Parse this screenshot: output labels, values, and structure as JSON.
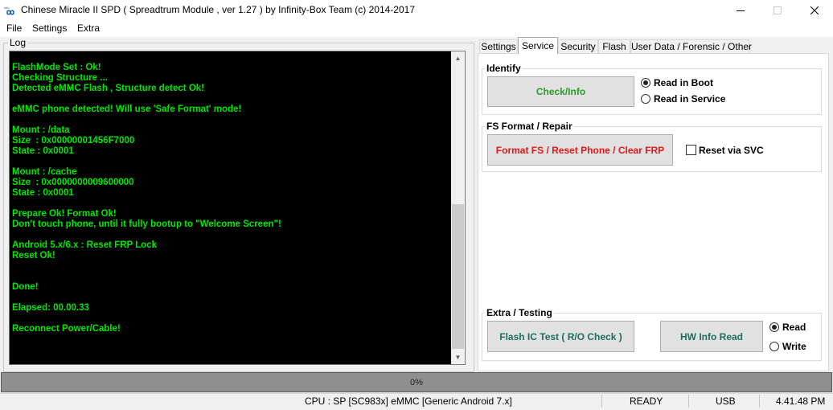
{
  "window": {
    "title": "Chinese Miracle II SPD ( Spreadtrum Module , ver 1.27 ) by Infinity-Box Team (c) 2014-2017",
    "minimize_icon": "minimize-icon",
    "maximize_icon": "maximize-icon",
    "close_icon": "close-icon"
  },
  "menu": {
    "items": [
      "File",
      "Settings",
      "Extra"
    ]
  },
  "log": {
    "label": "Log",
    "lines": [
      "FlashMode Set : Ok!",
      "Checking Structure ...",
      "Detected eMMC Flash , Structure detect Ok!",
      "",
      "eMMC phone detected! Will use 'Safe Format' mode!",
      "",
      "Mount : /data",
      "Size  : 0x00000001456F7000",
      "State : 0x0001",
      "",
      "Mount : /cache",
      "Size  : 0x0000000009600000",
      "State : 0x0001",
      "",
      "Prepare Ok! Format Ok!",
      "Don't touch phone, until it fully bootup to \"Welcome Screen\"!",
      "",
      "Android 5.x/6.x : Reset FRP Lock",
      "Reset Ok!",
      "",
      "",
      "Done!",
      "",
      "Elapsed: 00.00.33",
      "",
      "Reconnect Power/Cable!"
    ]
  },
  "tabs": [
    "Settings",
    "Service",
    "Security",
    "Flash",
    "User Data / Forensic / Other"
  ],
  "active_tab": "Service",
  "identify": {
    "label": "Identify",
    "button": "Check/Info",
    "options": [
      "Read in Boot",
      "Read in Service"
    ],
    "selected": "Read in Boot"
  },
  "fs_format": {
    "label": "FS Format / Repair",
    "button": "Format FS / Reset Phone / Clear FRP",
    "checkbox_label": "Reset via SVC",
    "checkbox_checked": false
  },
  "extra_testing": {
    "label": "Extra / Testing",
    "button_flash_ic": "Flash IC Test ( R/O Check )",
    "button_hw_info": "HW Info Read",
    "options": [
      "Read",
      "Write"
    ],
    "selected": "Read"
  },
  "progress": {
    "value": 0,
    "text": "0%"
  },
  "status": {
    "cpu": "CPU : SP [SC983x] eMMC [Generic Android 7.x]",
    "state": "READY",
    "connection": "USB",
    "time": "4.41.48 PM"
  },
  "colors": {
    "log_text": "#00e600",
    "log_background": "#000000",
    "button_check": "#2a9a2a",
    "button_format": "#e01818",
    "button_extra": "#1d6e5c"
  }
}
